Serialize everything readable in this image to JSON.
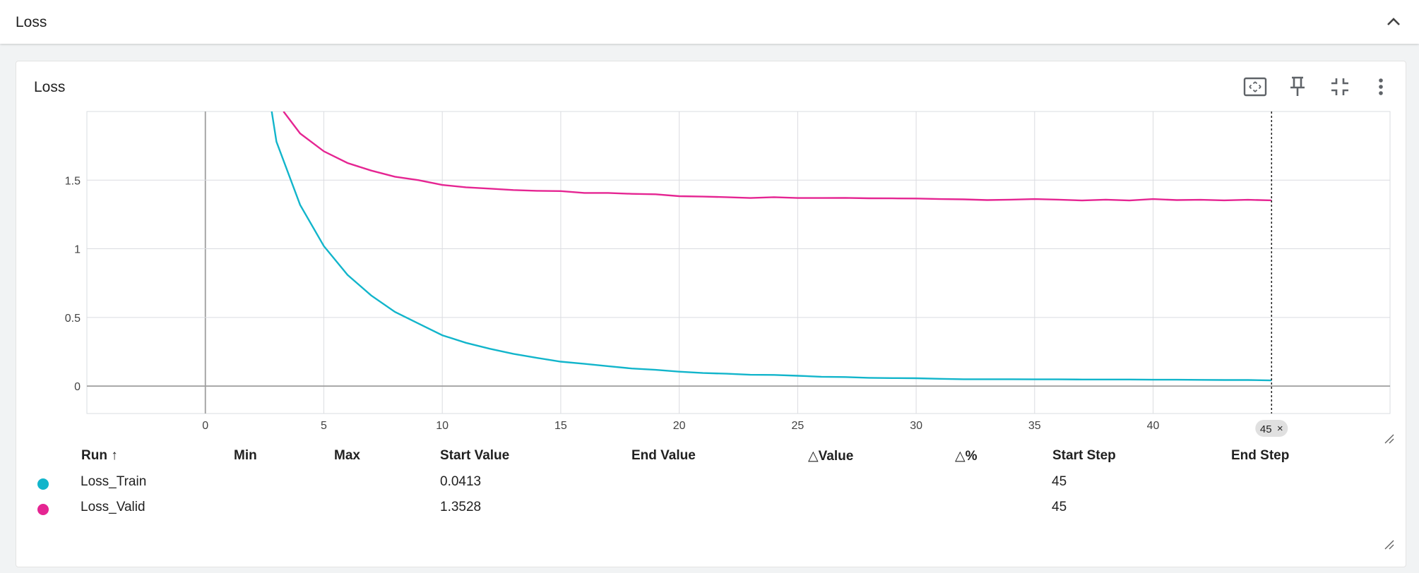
{
  "section": {
    "title": "Loss"
  },
  "card": {
    "title": "Loss"
  },
  "chart_data": {
    "type": "line",
    "xlim": [
      -5,
      50
    ],
    "ylim": [
      -0.2,
      2.0
    ],
    "x_ticks": [
      0,
      5,
      10,
      15,
      20,
      25,
      30,
      35,
      40
    ],
    "y_ticks": [
      0,
      0.5,
      1,
      1.5
    ],
    "y_tick_labels": [
      "0",
      "0.5",
      "1",
      "1.5"
    ],
    "grid": true,
    "series": [
      {
        "name": "Loss_Train",
        "color": "#12b5cb",
        "points": [
          [
            2.8,
            2.0
          ],
          [
            3,
            1.78
          ],
          [
            4,
            1.32
          ],
          [
            5,
            1.02
          ],
          [
            6,
            0.81
          ],
          [
            7,
            0.66
          ],
          [
            8,
            0.54
          ],
          [
            9,
            0.455
          ],
          [
            10,
            0.37
          ],
          [
            11,
            0.315
          ],
          [
            12,
            0.272
          ],
          [
            13,
            0.235
          ],
          [
            14,
            0.205
          ],
          [
            15,
            0.178
          ],
          [
            16,
            0.162
          ],
          [
            17,
            0.145
          ],
          [
            18,
            0.128
          ],
          [
            19,
            0.118
          ],
          [
            20,
            0.105
          ],
          [
            21,
            0.095
          ],
          [
            22,
            0.09
          ],
          [
            23,
            0.082
          ],
          [
            24,
            0.081
          ],
          [
            25,
            0.075
          ],
          [
            26,
            0.068
          ],
          [
            27,
            0.066
          ],
          [
            28,
            0.06
          ],
          [
            29,
            0.058
          ],
          [
            30,
            0.057
          ],
          [
            31,
            0.053
          ],
          [
            32,
            0.05
          ],
          [
            33,
            0.05
          ],
          [
            34,
            0.05
          ],
          [
            35,
            0.049
          ],
          [
            36,
            0.049
          ],
          [
            37,
            0.048
          ],
          [
            38,
            0.048
          ],
          [
            39,
            0.048
          ],
          [
            40,
            0.046
          ],
          [
            41,
            0.046
          ],
          [
            42,
            0.045
          ],
          [
            43,
            0.044
          ],
          [
            44,
            0.044
          ],
          [
            45,
            0.0413
          ]
        ]
      },
      {
        "name": "Loss_Valid",
        "color": "#e52592",
        "points": [
          [
            3.3,
            2.0
          ],
          [
            4,
            1.84
          ],
          [
            5,
            1.71
          ],
          [
            6,
            1.625
          ],
          [
            7,
            1.57
          ],
          [
            8,
            1.525
          ],
          [
            9,
            1.5
          ],
          [
            10,
            1.465
          ],
          [
            11,
            1.448
          ],
          [
            12,
            1.438
          ],
          [
            13,
            1.428
          ],
          [
            14,
            1.422
          ],
          [
            15,
            1.42
          ],
          [
            16,
            1.407
          ],
          [
            17,
            1.407
          ],
          [
            18,
            1.4
          ],
          [
            19,
            1.397
          ],
          [
            20,
            1.383
          ],
          [
            21,
            1.38
          ],
          [
            22,
            1.376
          ],
          [
            23,
            1.37
          ],
          [
            24,
            1.376
          ],
          [
            25,
            1.37
          ],
          [
            26,
            1.37
          ],
          [
            27,
            1.371
          ],
          [
            28,
            1.368
          ],
          [
            29,
            1.367
          ],
          [
            30,
            1.366
          ],
          [
            31,
            1.362
          ],
          [
            32,
            1.36
          ],
          [
            33,
            1.355
          ],
          [
            34,
            1.358
          ],
          [
            35,
            1.362
          ],
          [
            36,
            1.358
          ],
          [
            37,
            1.352
          ],
          [
            38,
            1.358
          ],
          [
            39,
            1.352
          ],
          [
            40,
            1.362
          ],
          [
            41,
            1.355
          ],
          [
            42,
            1.357
          ],
          [
            43,
            1.353
          ],
          [
            44,
            1.357
          ],
          [
            45,
            1.3528
          ]
        ]
      }
    ],
    "selected_step": 45,
    "selected_step_label": "45",
    "selected_step_close": "×"
  },
  "table": {
    "headers": {
      "run": "Run",
      "sort_arrow": "↑",
      "min": "Min",
      "max": "Max",
      "start_value": "Start Value",
      "end_value": "End Value",
      "delta_value": "Value",
      "delta_pct": "%",
      "start_step": "Start Step",
      "end_step": "End Step"
    },
    "rows": [
      {
        "color": "#12b5cb",
        "run": "Loss_Train",
        "min": "",
        "max": "",
        "start_value": "0.0413",
        "end_value": "",
        "delta_value": "",
        "delta_pct": "",
        "start_step": "45",
        "end_step": ""
      },
      {
        "color": "#e52592",
        "run": "Loss_Valid",
        "min": "",
        "max": "",
        "start_value": "1.3528",
        "end_value": "",
        "delta_value": "",
        "delta_pct": "",
        "start_step": "45",
        "end_step": ""
      }
    ]
  },
  "icons": {
    "collapse": "chevron-up-icon",
    "fit_domain": "fit-domain-icon",
    "pin": "pin-icon",
    "collapse_card": "collapse-fullscreen-icon",
    "more": "more-vert-icon",
    "resize": "resize-handle-icon"
  }
}
